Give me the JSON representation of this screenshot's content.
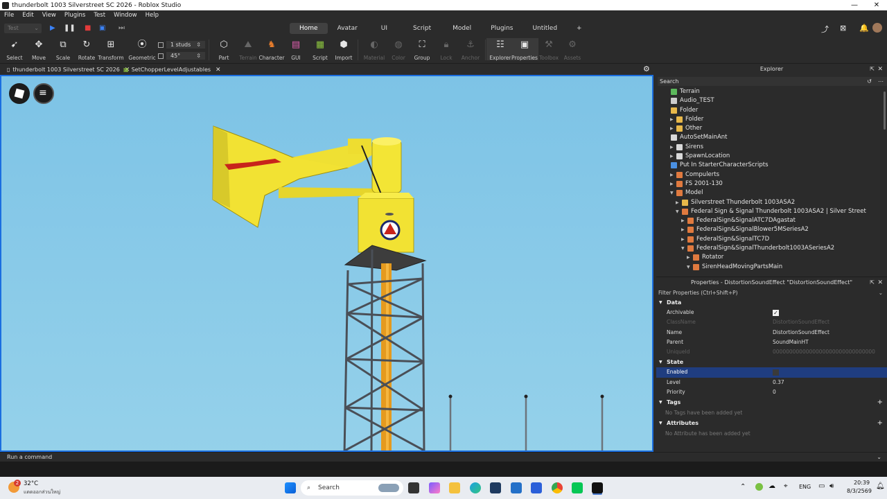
{
  "window": {
    "title": "thunderbolt 1003 Silverstreet SC 2026 - Roblox Studio",
    "controls": [
      "—",
      "❐",
      "✕"
    ]
  },
  "menu": [
    "File",
    "Edit",
    "View",
    "Plugins",
    "Test",
    "Window",
    "Help"
  ],
  "ribbon_tabs": {
    "test_selector": "Test",
    "tabs": [
      "Home",
      "Avatar",
      "UI",
      "Script",
      "Model",
      "Plugins",
      "Untitled"
    ],
    "active": "Home",
    "add": "+"
  },
  "tools": {
    "select": "Select",
    "move": "Move",
    "scale": "Scale",
    "rotate": "Rotate",
    "transform": "Transform",
    "geometric": "Geometric",
    "snap_move": "1 studs",
    "snap_rotate": "45°",
    "part": "Part",
    "terrain": "Terrain",
    "character": "Character",
    "gui": "GUI",
    "script": "Script",
    "import": "Import",
    "material": "Material",
    "color": "Color",
    "group": "Group",
    "lock": "Lock",
    "anchor": "Anchor",
    "explorer": "Explorer",
    "properties": "Properties",
    "toolbox": "Toolbox",
    "assets": "Assets"
  },
  "doc_tabs": [
    {
      "label": "thunderbolt 1003 Silverstreet SC 2026",
      "close": "✕"
    },
    {
      "label": "SetChopperLevelAdjustables",
      "close": "✕"
    }
  ],
  "explorer": {
    "title": "Explorer",
    "search_placeholder": "Search",
    "items": [
      {
        "label": "Terrain",
        "icon": "terrain-icon",
        "color": "#5cb85c"
      },
      {
        "label": "Audio_TEST",
        "icon": "sound-icon",
        "color": "#cccccc"
      },
      {
        "label": "Folder",
        "icon": "folder-icon",
        "color": "#e8b84a"
      },
      {
        "label": "Folder",
        "icon": "folder-icon",
        "color": "#e8b84a"
      },
      {
        "label": "Other",
        "icon": "folder-icon",
        "color": "#e8b84a"
      },
      {
        "label": "AutoSetMainAnt",
        "icon": "script-icon",
        "color": "#d9d9d9"
      },
      {
        "label": "Sirens",
        "icon": "hash-icon",
        "color": "#d9d9d9"
      },
      {
        "label": "SpawnLocation",
        "icon": "spawn-icon",
        "color": "#d9d9d9"
      },
      {
        "label": "Put In StarterCharacterScripts",
        "icon": "script-icon",
        "color": "#4a90e2"
      },
      {
        "label": "Compulerts",
        "icon": "model-icon",
        "color": "#e07a3f"
      },
      {
        "label": "FS 2001-130",
        "icon": "model-icon",
        "color": "#e07a3f"
      },
      {
        "label": "Model",
        "icon": "model-icon",
        "color": "#e07a3f"
      },
      {
        "label": "Silverstreet  Thunderbolt 1003ASA2",
        "icon": "folder-icon",
        "color": "#e8b84a"
      },
      {
        "label": "Federal Sign & Signal Thunderbolt 1003ASA2 | Silver Street",
        "icon": "model-icon",
        "color": "#e07a3f"
      },
      {
        "label": "FederalSign&SignalATC7DAgastat",
        "icon": "model-icon",
        "color": "#e07a3f"
      },
      {
        "label": "FederalSign&SignalBlower5MSeriesA2",
        "icon": "model-icon",
        "color": "#e07a3f"
      },
      {
        "label": "FederalSign&SignalTC7D",
        "icon": "model-icon",
        "color": "#e07a3f"
      },
      {
        "label": "FederalSign&SignalThunderbolt1003ASeriesA2",
        "icon": "model-icon",
        "color": "#e07a3f"
      },
      {
        "label": "Rotator",
        "icon": "model-icon",
        "color": "#e07a3f"
      },
      {
        "label": "SirenHeadMovingPartsMain",
        "icon": "model-icon",
        "color": "#e07a3f"
      }
    ]
  },
  "properties": {
    "title": "Properties - DistortionSoundEffect \"DistortionSoundEffect\"",
    "filter_placeholder": "Filter Properties (Ctrl+Shift+P)",
    "sections": {
      "data": "Data",
      "state": "State",
      "tags": "Tags",
      "attributes": "Attributes"
    },
    "data_rows": [
      {
        "name": "Archivable",
        "value": "✓"
      },
      {
        "name": "ClassName",
        "value": "DistortionSoundEffect"
      },
      {
        "name": "Name",
        "value": "DistortionSoundEffect"
      },
      {
        "name": "Parent",
        "value": "SoundMainHT"
      },
      {
        "name": "UniqueId",
        "value": "0000000000000000000000000000000"
      }
    ],
    "state_rows": [
      {
        "name": "Enabled",
        "value": ""
      },
      {
        "name": "Level",
        "value": "0.37"
      },
      {
        "name": "Priority",
        "value": "0"
      }
    ],
    "tags_note": "No Tags have been added yet",
    "attributes_note": "No Attribute has been added yet"
  },
  "command_bar": {
    "placeholder": "Run a command"
  },
  "taskbar": {
    "weather_temp": "32°C",
    "weather_desc": "แดดออกส่วนใหญ่",
    "weather_badge": "2",
    "search": "Search",
    "lang": "ENG",
    "time": "20:39",
    "date": "8/3/2569"
  },
  "colors": {
    "accent": "#1a6ee0",
    "selection": "#1f3d80",
    "siren_yellow": "#f2e233",
    "sky": "#86cbe8"
  }
}
